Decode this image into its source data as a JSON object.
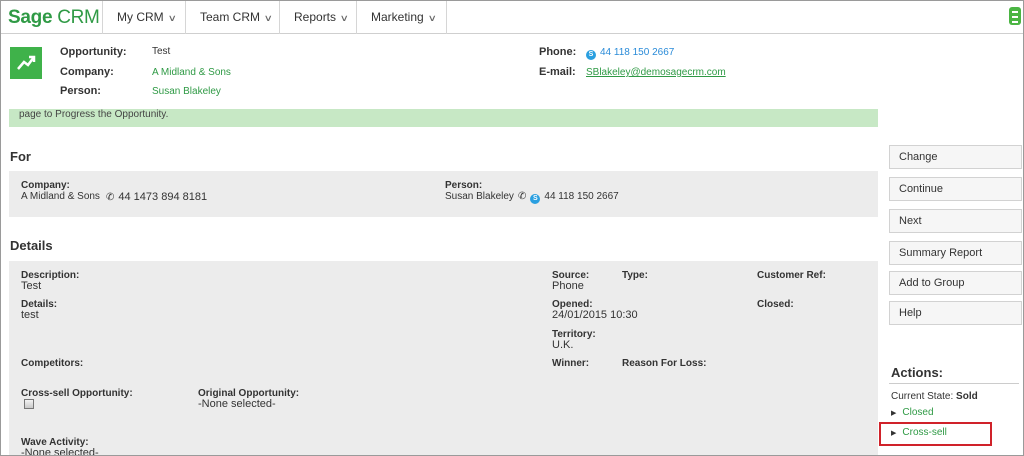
{
  "app": {
    "logo_brand": "Sage",
    "logo_product": "CRM",
    "nav": [
      "My CRM",
      "Team CRM",
      "Reports",
      "Marketing"
    ]
  },
  "summary": {
    "opportunity_label": "Opportunity:",
    "opportunity_value": "Test",
    "company_label": "Company:",
    "company_value": "A Midland & Sons",
    "person_label": "Person:",
    "person_value": "Susan Blakeley",
    "phone_label": "Phone:",
    "phone_value": "44 118 150 2667",
    "email_label": "E-mail:",
    "email_value": "SBlakeley@demosagecrm.com"
  },
  "banner_text": "page to Progress the Opportunity.",
  "for_section": {
    "title": "For",
    "company_label": "Company:",
    "company_value": "A Midland & Sons",
    "company_phone": "44 1473 894 8181",
    "person_label": "Person:",
    "person_value": "Susan Blakeley",
    "person_phone": "44 118 150 2667"
  },
  "details_section": {
    "title": "Details",
    "description_label": "Description:",
    "description_value": "Test",
    "details_label": "Details:",
    "details_value": "test",
    "source_label": "Source:",
    "source_value": "Phone",
    "type_label": "Type:",
    "customer_ref_label": "Customer Ref:",
    "opened_label": "Opened:",
    "opened_value": "24/01/2015 10:30",
    "closed_label": "Closed:",
    "territory_label": "Territory:",
    "territory_value": "U.K.",
    "competitors_label": "Competitors:",
    "winner_label": "Winner:",
    "reason_label": "Reason For Loss:",
    "cross_sell_label": "Cross-sell Opportunity:",
    "original_label": "Original Opportunity:",
    "original_value": "-None selected-",
    "wave_label": "Wave Activity:",
    "wave_value": "-None selected-"
  },
  "buttons": {
    "change": "Change",
    "continue": "Continue",
    "next": "Next",
    "summary_report": "Summary Report",
    "add_to_group": "Add to Group",
    "help": "Help"
  },
  "actions": {
    "title": "Actions:",
    "state_label": "Current State:",
    "state_value": "Sold",
    "items": [
      "Closed",
      "Cross-sell"
    ]
  }
}
